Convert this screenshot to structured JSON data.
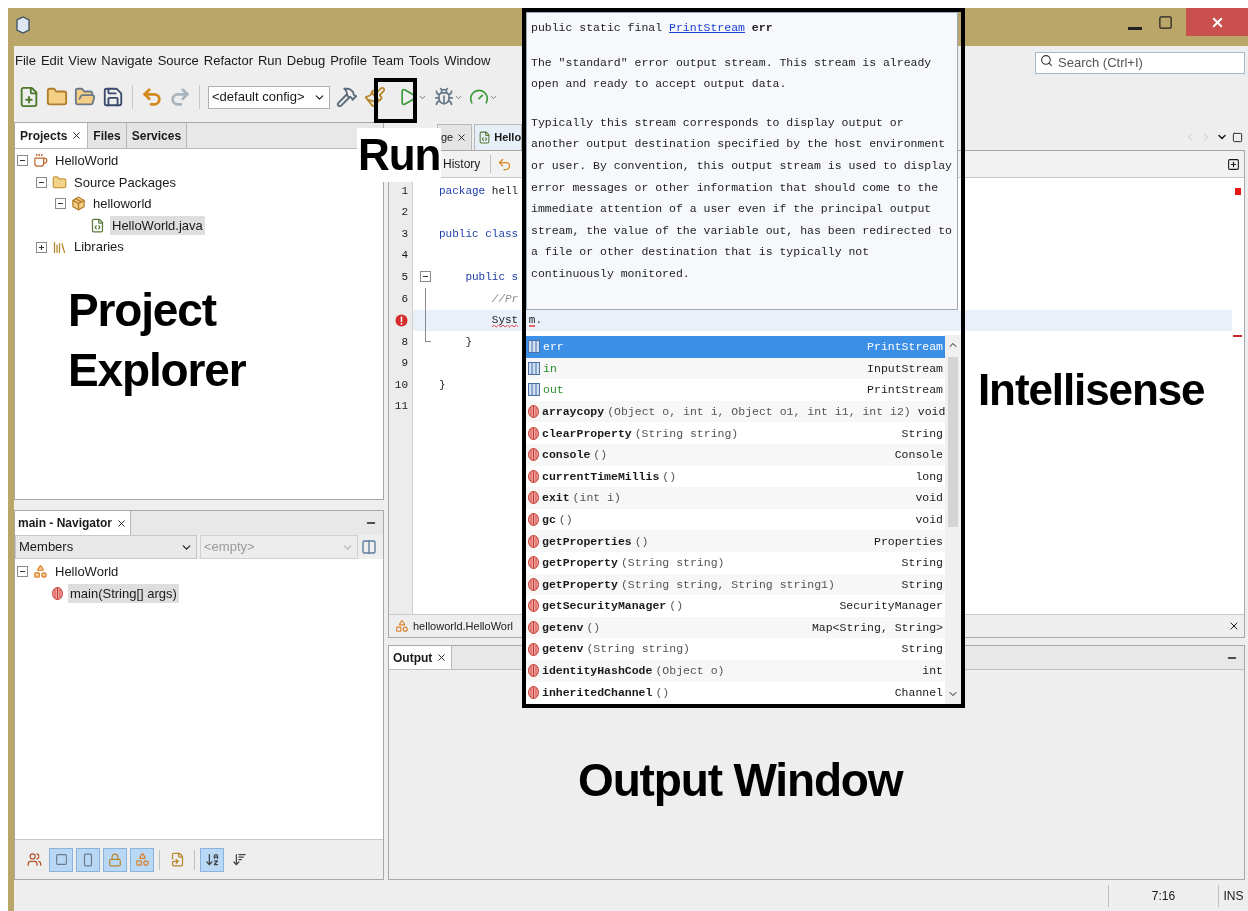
{
  "menu": [
    "File",
    "Edit",
    "View",
    "Navigate",
    "Source",
    "Refactor",
    "Run",
    "Debug",
    "Profile",
    "Team",
    "Tools",
    "Window"
  ],
  "search": {
    "placeholder": "Search (Ctrl+I)"
  },
  "toolbar": {
    "config": "<default config>"
  },
  "projects_panel": {
    "tabs": [
      {
        "label": "Projects",
        "selected": true,
        "closable": true
      },
      {
        "label": "Files",
        "selected": false,
        "closable": false
      },
      {
        "label": "Services",
        "selected": false,
        "closable": false
      }
    ],
    "tree": [
      {
        "label": "HelloWorld",
        "kind": "project",
        "expanded": true,
        "selected": false,
        "children": [
          {
            "label": "Source Packages",
            "kind": "folder",
            "expanded": true,
            "selected": false,
            "children": [
              {
                "label": "helloworld",
                "kind": "package",
                "expanded": true,
                "selected": false,
                "children": [
                  {
                    "label": "HelloWorld.java",
                    "kind": "file",
                    "selected": true
                  }
                ]
              }
            ]
          },
          {
            "label": "Libraries",
            "kind": "library",
            "expanded": false,
            "selected": false
          }
        ]
      }
    ]
  },
  "navigator": {
    "title": "main - Navigator",
    "filter": "Members",
    "secondary": {
      "placeholder": "<empty>"
    },
    "tree": [
      {
        "label": "HelloWorld",
        "kind": "class",
        "expanded": true,
        "selected": false,
        "children": [
          {
            "label": "main(String[] args)",
            "kind": "method",
            "selected": true
          }
        ]
      }
    ],
    "filter_buttons": [
      {
        "kind": "inherited",
        "on": false
      },
      {
        "kind": "fields",
        "on": true
      },
      {
        "kind": "static",
        "on": true
      },
      {
        "kind": "private",
        "on": true
      },
      {
        "kind": "inner",
        "on": true
      },
      {
        "kind": "fqn",
        "on": false
      },
      {
        "kind": "sort-name",
        "on": true
      },
      {
        "kind": "sort-source",
        "on": false
      }
    ]
  },
  "editor": {
    "tabs": [
      {
        "label": "ge",
        "selected": false
      },
      {
        "label": "Hello",
        "selected": true
      }
    ],
    "view_tab": "History",
    "lines": [
      {
        "number": "1",
        "kind": "plain",
        "segments": [
          {
            "kind": "keyword",
            "text": "package"
          },
          {
            "kind": "plain",
            "text": " hell"
          }
        ]
      },
      {
        "number": "2",
        "kind": "plain"
      },
      {
        "number": "3",
        "kind": "plain",
        "segments": [
          {
            "kind": "keyword",
            "text": "public class"
          }
        ]
      },
      {
        "number": "4",
        "kind": "plain"
      },
      {
        "number": "5",
        "kind": "fold-start",
        "segments": [
          {
            "kind": "keyword",
            "text": "    public s"
          }
        ]
      },
      {
        "number": "6",
        "kind": "fold-body",
        "segments": [
          {
            "kind": "comment",
            "text": "        //Pr"
          }
        ]
      },
      {
        "error": true,
        "current": true,
        "kind": "fold-body",
        "segments": [
          {
            "kind": "error",
            "text": "        Syst"
          },
          {
            "kind": "error-resumed",
            "text": "m"
          },
          {
            "kind": "plain",
            "text": "."
          }
        ]
      },
      {
        "number": "8",
        "kind": "fold-end",
        "segments": [
          {
            "kind": "plain",
            "text": "    }"
          }
        ]
      },
      {
        "number": "9",
        "kind": "plain"
      },
      {
        "number": "10",
        "kind": "plain",
        "segments": [
          {
            "kind": "plain",
            "text": "}"
          }
        ]
      },
      {
        "number": "11",
        "kind": "plain"
      }
    ],
    "breadcrumb": "helloworld.HelloWorl"
  },
  "javadoc": {
    "modifiers": "public static final",
    "type": "PrintStream",
    "name": "err",
    "paragraphs": [
      "The \"standard\" error output stream. This stream is already open and ready to accept output data.",
      "Typically this stream corresponds to display output or another output destination specified by the host environment or user. By convention, this output stream is used to display error messages or other information that should come to the immediate attention of a user even if the principal output stream, the value of the variable out, has been redirected to a file or other destination that is typically not continuously monitored."
    ]
  },
  "completion": {
    "items": [
      {
        "kind": "field",
        "name": "err",
        "type": "PrintStream",
        "selected": true
      },
      {
        "kind": "field",
        "name": "in",
        "type": "InputStream",
        "selected": false
      },
      {
        "kind": "field",
        "name": "out",
        "type": "PrintStream",
        "selected": false
      },
      {
        "kind": "method",
        "name": "arraycopy",
        "params": "(Object o, int i, Object o1, int i1, int i2)",
        "type": "void",
        "selected": false
      },
      {
        "kind": "method",
        "name": "clearProperty",
        "params": "(String string)",
        "type": "String",
        "selected": false
      },
      {
        "kind": "method",
        "name": "console",
        "params": "()",
        "type": "Console",
        "selected": false
      },
      {
        "kind": "method",
        "name": "currentTimeMillis",
        "params": "()",
        "type": "long",
        "selected": false
      },
      {
        "kind": "method",
        "name": "exit",
        "params": "(int i)",
        "type": "void",
        "selected": false
      },
      {
        "kind": "method",
        "name": "gc",
        "params": "()",
        "type": "void",
        "selected": false
      },
      {
        "kind": "method",
        "name": "getProperties",
        "params": "()",
        "type": "Properties",
        "selected": false
      },
      {
        "kind": "method",
        "name": "getProperty",
        "params": "(String string)",
        "type": "String",
        "selected": false
      },
      {
        "kind": "method",
        "name": "getProperty",
        "params": "(String string, String string1)",
        "type": "String",
        "selected": false
      },
      {
        "kind": "method",
        "name": "getSecurityManager",
        "params": "()",
        "type": "SecurityManager",
        "selected": false
      },
      {
        "kind": "method",
        "name": "getenv",
        "params": "()",
        "type": "Map<String, String>",
        "selected": false
      },
      {
        "kind": "method",
        "name": "getenv",
        "params": "(String string)",
        "type": "String",
        "selected": false
      },
      {
        "kind": "method",
        "name": "identityHashCode",
        "params": "(Object o)",
        "type": "int",
        "selected": false
      },
      {
        "kind": "method",
        "name": "inheritedChannel",
        "params": "()",
        "type": "Channel",
        "selected": false
      }
    ]
  },
  "output": {
    "tab": "Output"
  },
  "status_bar": {
    "position": "7:16",
    "mode": "INS"
  },
  "annotations": [
    {
      "kind": "run",
      "lines": [
        "Run"
      ]
    },
    {
      "kind": "projects",
      "lines": [
        "Project",
        "Explorer"
      ]
    },
    {
      "kind": "intellisense",
      "lines": [
        "Intellisense"
      ]
    },
    {
      "kind": "output",
      "lines": [
        "Output Window"
      ]
    }
  ]
}
